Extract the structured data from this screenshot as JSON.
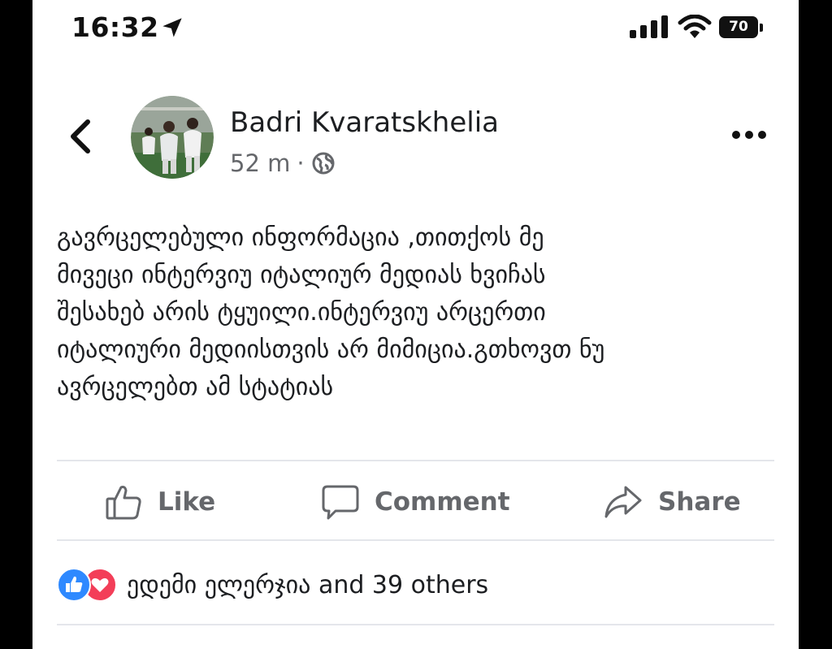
{
  "status_bar": {
    "time": "16:32",
    "battery": "70",
    "icons": [
      "location-arrow-icon",
      "cellular-signal-icon",
      "wifi-icon",
      "battery-icon"
    ]
  },
  "post": {
    "author": "Badri Kvaratskhelia",
    "time_ago": "52 m",
    "separator": "·",
    "audience_icon": "globe-icon",
    "text_lines": [
      "გავრცელებული ინფორმაცია ,თითქოს მე",
      "მივეცი ინტერვიუ იტალიურ მედიას ხვიჩას",
      "შესახებ არის ტყუილი.ინტერვიუ არცერთი",
      "იტალიური მედიისთვის არ მიმიცია.გთხოვთ ნუ",
      "ავრცელებთ ამ სტატიას"
    ]
  },
  "actions": {
    "like": "Like",
    "comment": "Comment",
    "share": "Share"
  },
  "reactions": {
    "summary": "ედემი ელერჯია and 39 others",
    "icons": [
      "like-reaction-icon",
      "love-reaction-icon"
    ]
  },
  "colors": {
    "text": "#1c1e21",
    "secondary": "#65676b",
    "like_blue": "#2e89ff",
    "love_red": "#f33e58"
  }
}
